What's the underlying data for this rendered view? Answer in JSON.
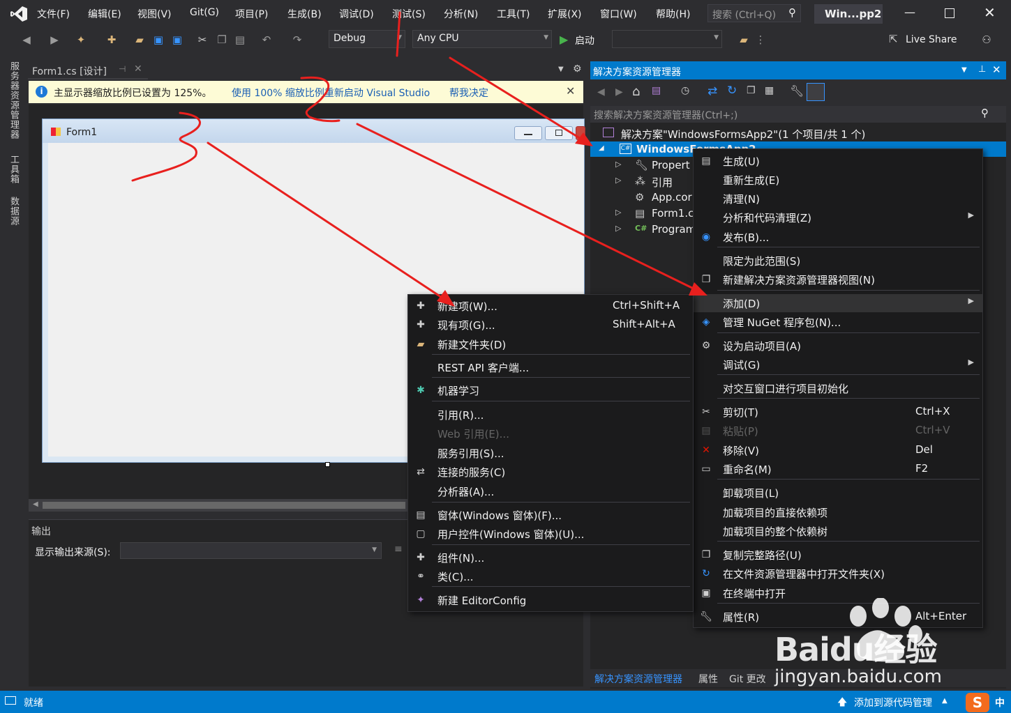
{
  "menubar": {
    "items": [
      "文件(F)",
      "编辑(E)",
      "视图(V)",
      "Git(G)",
      "项目(P)",
      "生成(B)",
      "调试(D)",
      "测试(S)",
      "分析(N)",
      "工具(T)",
      "扩展(X)",
      "窗口(W)",
      "帮助(H)"
    ],
    "search_placeholder": "搜索 (Ctrl+Q)",
    "window_title": "Win...pp2"
  },
  "toolbar": {
    "config": "Debug",
    "platform": "Any CPU",
    "start_label": "启动",
    "live_share": "Live Share"
  },
  "left_strip": [
    "服务器资源管理器",
    "工具箱",
    "数据源"
  ],
  "document": {
    "tab_title": "Form1.cs [设计]",
    "info_message": "主显示器缩放比例已设置为 125%。",
    "info_link1": "使用 100% 缩放比例重新启动 Visual Studio",
    "info_link2": "帮我决定",
    "form_title": "Form1"
  },
  "output": {
    "title": "输出",
    "source_label": "显示输出来源(S):"
  },
  "solution_explorer": {
    "title": "解决方案资源管理器",
    "search_placeholder": "搜索解决方案资源管理器(Ctrl+;)",
    "tree": {
      "solution": "解决方案\"WindowsFormsApp2\"(1 个项目/共 1 个)",
      "project": "WindowsFormsApp2",
      "properties": "Propert",
      "references": "引用",
      "appconfig": "App.cor",
      "form1": "Form1.c",
      "program": "Program"
    },
    "bottom_tabs": [
      "解决方案资源管理器",
      "属性",
      "Git 更改"
    ]
  },
  "context_menu_project": [
    {
      "label": "生成(U)",
      "icon": "build-icon"
    },
    {
      "label": "重新生成(E)"
    },
    {
      "label": "清理(N)"
    },
    {
      "label": "分析和代码清理(Z)",
      "submenu": true
    },
    {
      "label": "发布(B)...",
      "icon": "publish-icon"
    },
    {
      "label": "限定为此范围(S)"
    },
    {
      "label": "新建解决方案资源管理器视图(N)",
      "icon": "new-view-icon"
    },
    {
      "label": "添加(D)",
      "submenu": true,
      "highlighted": true
    },
    {
      "label": "管理 NuGet 程序包(N)...",
      "icon": "nuget-icon"
    },
    {
      "label": "设为启动项目(A)",
      "icon": "gear-icon"
    },
    {
      "label": "调试(G)",
      "submenu": true
    },
    {
      "label": "对交互窗口进行项目初始化"
    },
    {
      "label": "剪切(T)",
      "shortcut": "Ctrl+X",
      "icon": "cut-icon"
    },
    {
      "label": "粘贴(P)",
      "shortcut": "Ctrl+V",
      "disabled": true,
      "icon": "paste-icon"
    },
    {
      "label": "移除(V)",
      "shortcut": "Del",
      "icon": "remove-icon"
    },
    {
      "label": "重命名(M)",
      "shortcut": "F2",
      "icon": "rename-icon"
    },
    {
      "label": "卸载项目(L)"
    },
    {
      "label": "加载项目的直接依赖项"
    },
    {
      "label": "加载项目的整个依赖树"
    },
    {
      "label": "复制完整路径(U)",
      "icon": "copy-path-icon"
    },
    {
      "label": "在文件资源管理器中打开文件夹(X)",
      "icon": "open-folder-icon"
    },
    {
      "label": "在终端中打开",
      "icon": "terminal-icon"
    },
    {
      "label": "属性(R)",
      "shortcut": "Alt+Enter",
      "icon": "wrench-icon"
    }
  ],
  "context_menu_add": [
    {
      "label": "新建项(W)...",
      "shortcut": "Ctrl+Shift+A",
      "icon": "new-item-icon"
    },
    {
      "label": "现有项(G)...",
      "shortcut": "Shift+Alt+A",
      "icon": "existing-item-icon"
    },
    {
      "label": "新建文件夹(D)",
      "icon": "new-folder-icon"
    },
    {
      "label": "REST API 客户端..."
    },
    {
      "label": "机器学习",
      "icon": "ml-icon"
    },
    {
      "label": "引用(R)..."
    },
    {
      "label": "Web 引用(E)...",
      "disabled": true
    },
    {
      "label": "服务引用(S)..."
    },
    {
      "label": "连接的服务(C)",
      "icon": "connected-service-icon"
    },
    {
      "label": "分析器(A)..."
    },
    {
      "label": "窗体(Windows 窗体)(F)...",
      "icon": "form-icon"
    },
    {
      "label": "用户控件(Windows 窗体)(U)...",
      "icon": "user-control-icon"
    },
    {
      "label": "组件(N)...",
      "icon": "component-icon"
    },
    {
      "label": "类(C)...",
      "icon": "class-icon"
    },
    {
      "label": "新建 EditorConfig",
      "icon": "editorconfig-icon"
    }
  ],
  "status": {
    "ready": "就绪",
    "source_control": "添加到源代码管理",
    "ime": "中"
  },
  "watermark": {
    "brand": "Baidu经验",
    "url": "jingyan.baidu.com"
  },
  "colors": {
    "accent": "#007acc",
    "background": "#2d2d30",
    "annotation": "#e8201e"
  }
}
